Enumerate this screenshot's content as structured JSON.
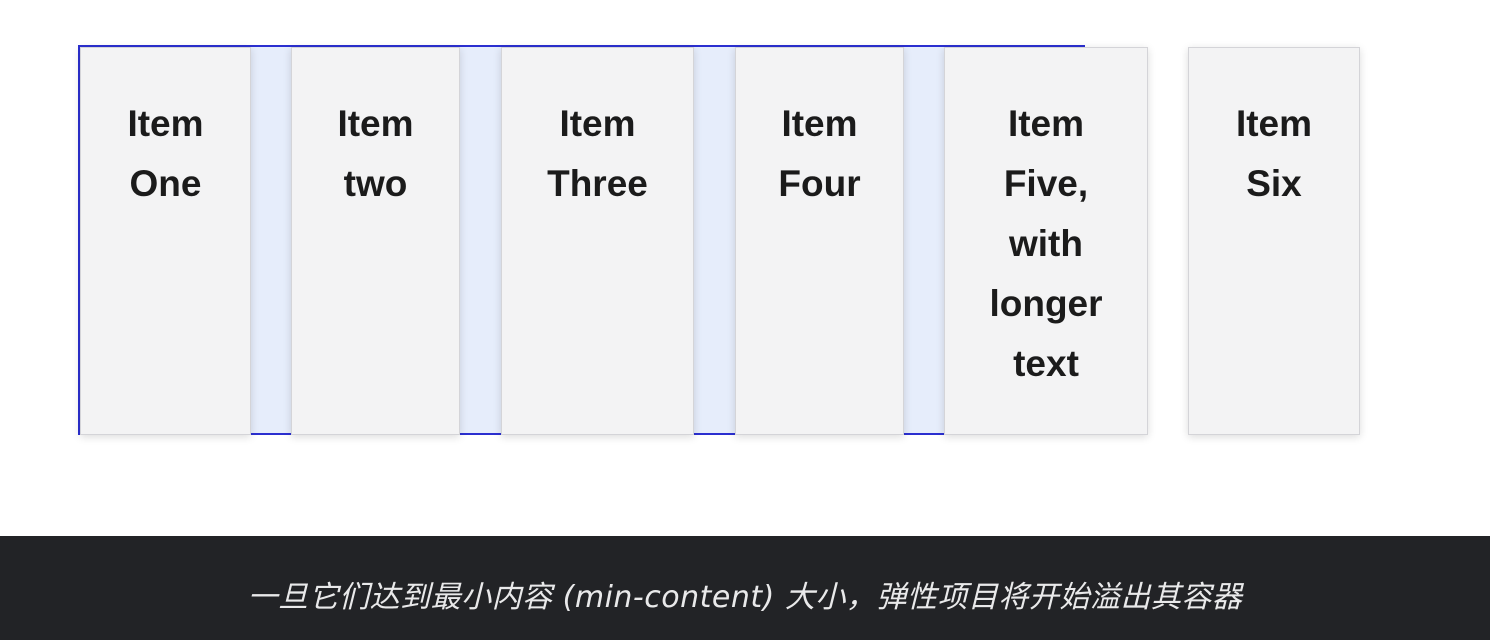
{
  "items": [
    {
      "label": "Item\nOne"
    },
    {
      "label": "Item\ntwo"
    },
    {
      "label": "Item\nThree"
    },
    {
      "label": "Item\nFour"
    },
    {
      "label": "Item\nFive,\nwith\nlonger\ntext"
    },
    {
      "label": "Item\nSix"
    }
  ],
  "caption": "一旦它们达到最小内容 (min-content) 大小，弹性项目将开始溢出其容器",
  "colors": {
    "container_border": "#2b2fd0",
    "container_fill": "#e6edfb",
    "item_fill": "#f3f3f4",
    "caption_bar": "#222326"
  }
}
